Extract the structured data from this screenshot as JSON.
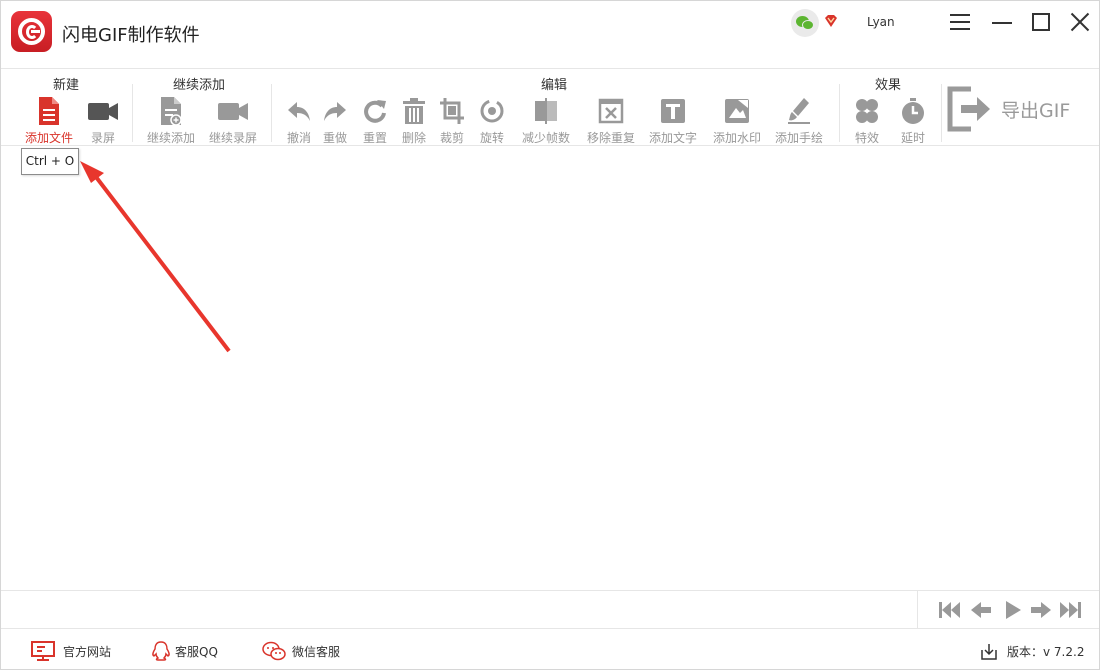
{
  "app": {
    "title": "闪电GIF制作软件",
    "username": "Lyan",
    "accent": "#d9342b"
  },
  "toolbar": {
    "groups": [
      {
        "label": "新建",
        "items": [
          {
            "label": "添加文件",
            "icon": "add-file-icon",
            "active": true
          },
          {
            "label": "录屏",
            "icon": "video-camera-icon"
          }
        ]
      },
      {
        "label": "继续添加",
        "items": [
          {
            "label": "继续添加",
            "icon": "add-file-icon"
          },
          {
            "label": "继续录屏",
            "icon": "video-camera-icon"
          }
        ]
      },
      {
        "label": "编辑",
        "items": [
          {
            "label": "撤消",
            "icon": "undo-icon"
          },
          {
            "label": "重做",
            "icon": "redo-icon"
          },
          {
            "label": "重置",
            "icon": "refresh-icon"
          },
          {
            "label": "删除",
            "icon": "trash-icon"
          },
          {
            "label": "裁剪",
            "icon": "crop-icon"
          },
          {
            "label": "旋转",
            "icon": "rotate-icon"
          },
          {
            "label": "减少帧数",
            "icon": "reduce-frames-icon"
          },
          {
            "label": "移除重复",
            "icon": "remove-duplicate-icon"
          },
          {
            "label": "添加文字",
            "icon": "text-icon"
          },
          {
            "label": "添加水印",
            "icon": "watermark-icon"
          },
          {
            "label": "添加手绘",
            "icon": "brush-icon"
          }
        ]
      },
      {
        "label": "效果",
        "items": [
          {
            "label": "特效",
            "icon": "effects-icon"
          },
          {
            "label": "延时",
            "icon": "timer-icon"
          }
        ]
      }
    ],
    "export_label": "导出GIF"
  },
  "tooltip": {
    "text": "Ctrl + O"
  },
  "footer": {
    "website": "官方网站",
    "qq": "客服QQ",
    "wechat": "微信客服",
    "version": "版本：v 7.2.2"
  }
}
